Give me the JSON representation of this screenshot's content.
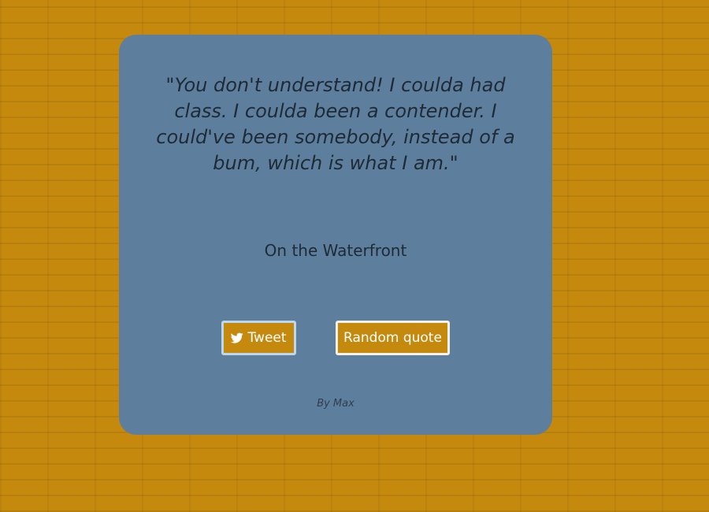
{
  "quote": {
    "text": "\"You don't understand! I coulda had class. I coulda been a contender. I could've been somebody, instead of a bum, which is what I am.\"",
    "source": "On the Waterfront"
  },
  "buttons": {
    "tweet_label": "Tweet",
    "tweet_icon": "twitter-icon",
    "random_label": "Random quote"
  },
  "footer": {
    "credit": "By Max"
  },
  "colors": {
    "background": "#c5890e",
    "card": "#5d7e9c",
    "text": "#1e2b36",
    "button": "#c5890e"
  }
}
